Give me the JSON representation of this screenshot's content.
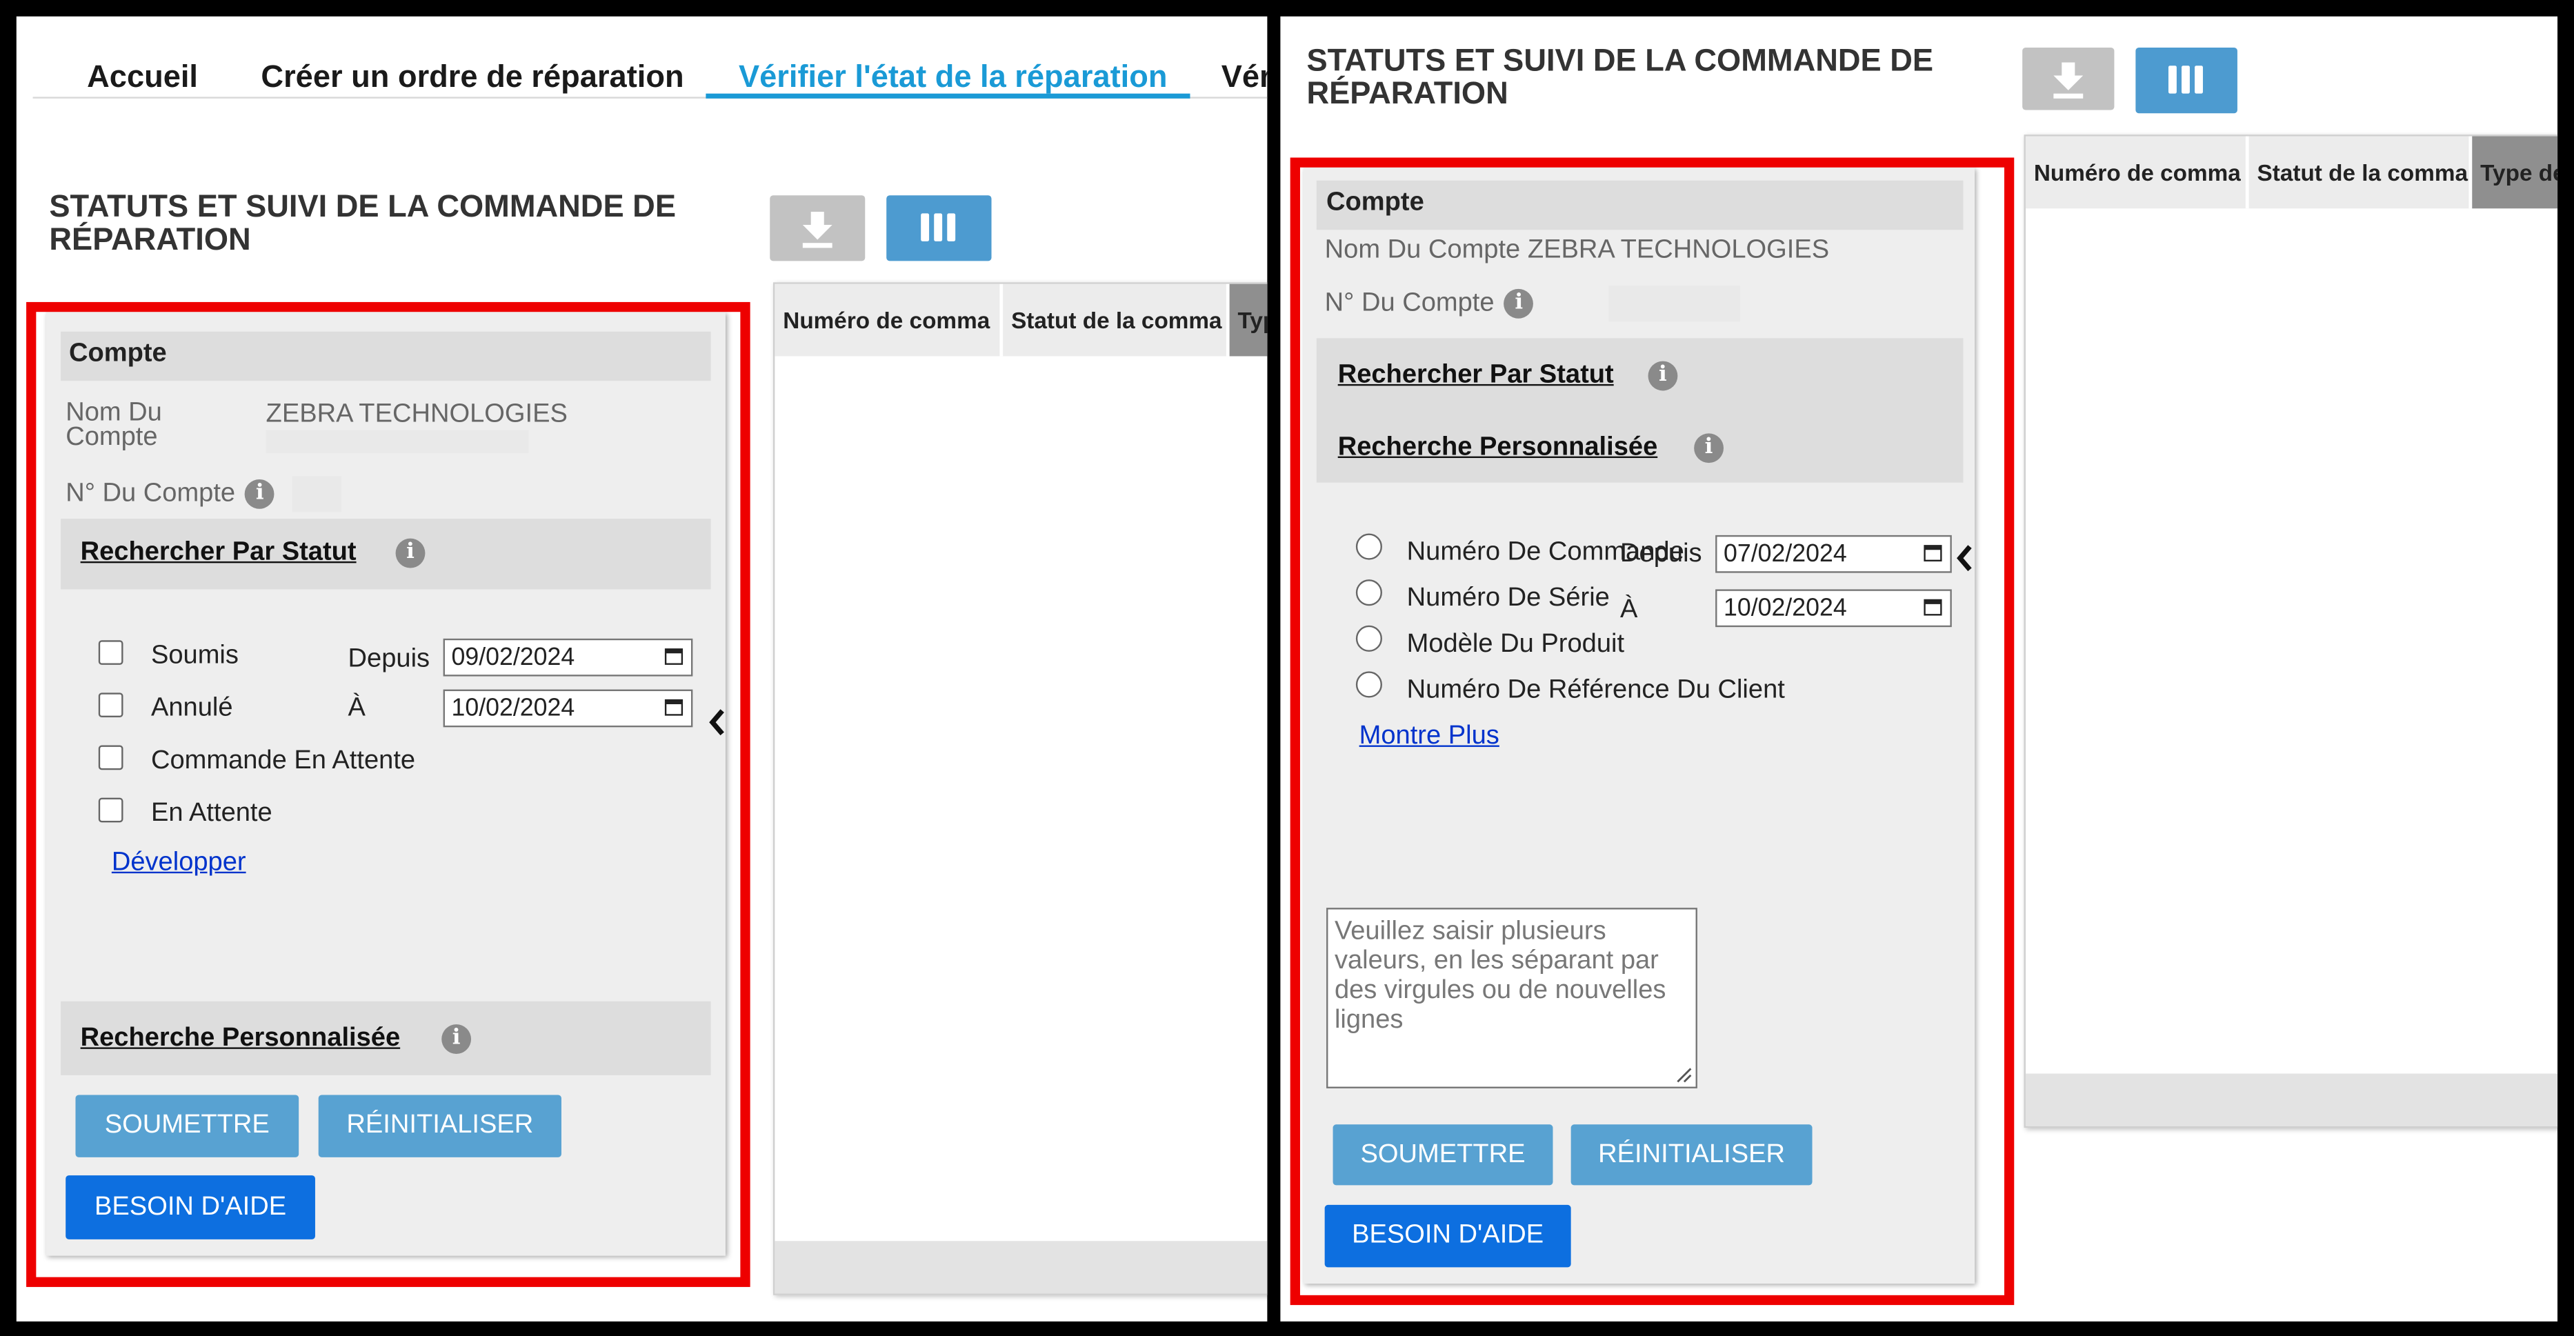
{
  "nav": {
    "tabs": [
      "Accueil",
      "Créer un ordre de réparation",
      "Vérifier l'état de la réparation",
      "Vér"
    ]
  },
  "page": {
    "title_line1": "STATUTS ET SUIVI DE LA COMMANDE DE",
    "title_line2": "RÉPARATION"
  },
  "toolbar": {
    "download_icon": "download-icon",
    "columns_icon": "columns-icon"
  },
  "grid": {
    "left_headers": [
      "Numéro de comma",
      "Statut de la comma",
      "Typ"
    ],
    "right_headers": [
      "Numéro de comma",
      "Statut de la comma",
      "Type de"
    ]
  },
  "account": {
    "section_title": "Compte",
    "name_label_line1": "Nom Du",
    "name_label_line2": "Compte",
    "name_label": "Nom Du Compte",
    "name_value": "ZEBRA TECHNOLOGIES",
    "number_label": "N° Du Compte"
  },
  "status_search": {
    "title": "Rechercher Par Statut",
    "options": [
      "Soumis",
      "Annulé",
      "Commande En Attente",
      "En Attente"
    ],
    "from_label": "Depuis",
    "to_label": "À",
    "from_date": "09/02/2024",
    "to_date": "10/02/2024",
    "expand_link": "Développer"
  },
  "custom_search": {
    "title": "Recherche Personnalisée",
    "options": [
      "Numéro De Commande",
      "Numéro De Série",
      "Modèle Du Produit",
      "Numéro De Référence Du Client"
    ],
    "from_label": "Depuis",
    "to_label": "À",
    "from_date": "07/02/2024",
    "to_date": "10/02/2024",
    "more_link": "Montre Plus",
    "textarea_placeholder": "Veuillez saisir plusieurs valeurs, en les séparant par des virgules ou de nouvelles lignes"
  },
  "actions": {
    "submit": "SOUMETTRE",
    "reset": "RÉINITIALISER",
    "help": "BESOIN D'AIDE"
  },
  "colors": {
    "highlight": "#ee0000",
    "active_tab": "#1a9ad6",
    "button": "#58a2d2",
    "help_button": "#0d6fe0"
  }
}
